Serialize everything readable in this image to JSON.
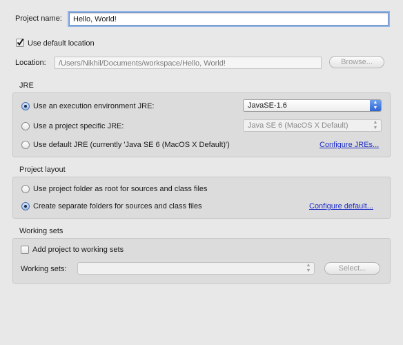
{
  "project": {
    "name_label": "Project name:",
    "name_value": "Hello, World!",
    "use_default_location_label": "Use default location",
    "location_label": "Location:",
    "location_value": "/Users/Nikhil/Documents/workspace/Hello, World!",
    "browse_label": "Browse..."
  },
  "jre": {
    "title": "JRE",
    "exec_env_label": "Use an execution environment JRE:",
    "exec_env_value": "JavaSE-1.6",
    "project_specific_label": "Use a project specific JRE:",
    "project_specific_value": "Java SE 6 (MacOS X Default)",
    "default_label": "Use default JRE (currently 'Java SE 6 (MacOS X Default)')",
    "configure_link": "Configure JREs..."
  },
  "layout": {
    "title": "Project layout",
    "root_label": "Use project folder as root for sources and class files",
    "separate_label": "Create separate folders for sources and class files",
    "configure_link": "Configure default..."
  },
  "working_sets": {
    "title": "Working sets",
    "add_label": "Add project to working sets",
    "sets_label": "Working sets:",
    "select_label": "Select..."
  },
  "colors": {
    "accent": "#2f65d2",
    "link": "#1d2dc7",
    "background": "#e8e8e8"
  }
}
